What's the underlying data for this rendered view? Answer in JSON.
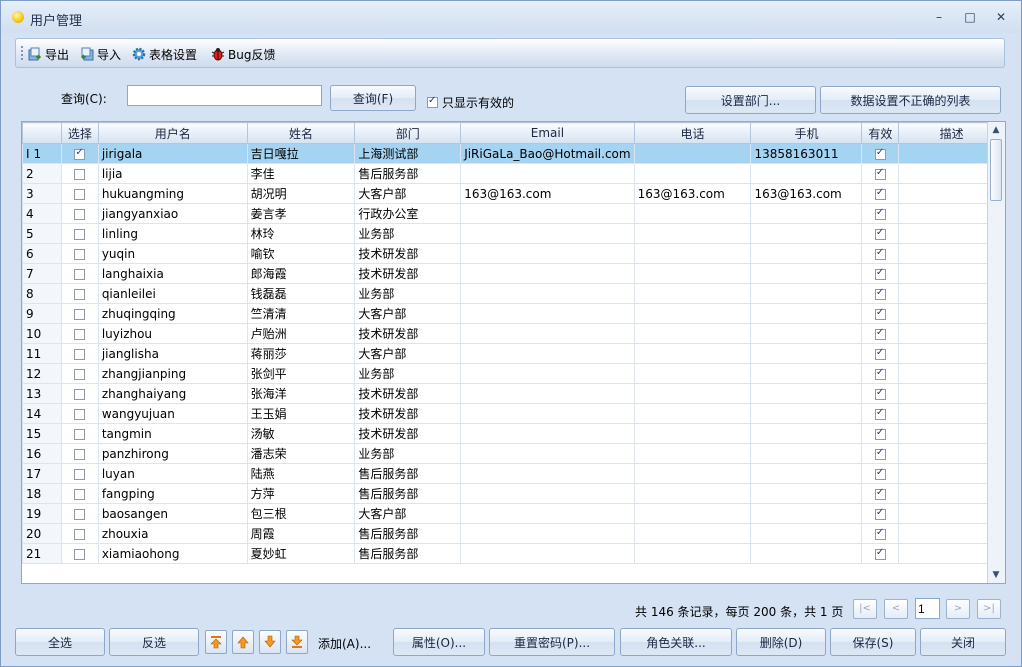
{
  "window": {
    "title": "用户管理",
    "controls": [
      "–",
      "□",
      "✕"
    ]
  },
  "toolbar": {
    "export_label": "导出",
    "import_label": "导入",
    "grid_settings_label": "表格设置",
    "bug_label": "Bug反馈"
  },
  "query": {
    "label": "查询(C):",
    "value": "",
    "button": "查询(F)",
    "only_valid_label": "只显示有效的",
    "only_valid_checked": true,
    "set_dept_button": "设置部门...",
    "bad_data_button": "数据设置不正确的列表"
  },
  "table": {
    "columns": [
      "",
      "选择",
      "用户名",
      "姓名",
      "部门",
      "Email",
      "电话",
      "手机",
      "有效",
      "描述"
    ],
    "rows": [
      {
        "num": "1",
        "indicator": "I",
        "select": true,
        "username": "jirigala",
        "name": "吉日嘎拉",
        "dept": "上海测试部",
        "email": "JiRiGaLa_Bao@Hotmail.com",
        "phone": "",
        "mobile": "13858163011",
        "valid": true,
        "desc": ""
      },
      {
        "num": "2",
        "select": false,
        "username": "lijia",
        "name": "李佳",
        "dept": "售后服务部",
        "email": "",
        "phone": "",
        "mobile": "",
        "valid": true,
        "desc": ""
      },
      {
        "num": "3",
        "select": false,
        "username": "hukuangming",
        "name": "胡况明",
        "dept": "大客户部",
        "email": "163@163.com",
        "phone": "163@163.com",
        "mobile": "163@163.com",
        "valid": true,
        "desc": ""
      },
      {
        "num": "4",
        "select": false,
        "username": "jiangyanxiao",
        "name": "姜言孝",
        "dept": "行政办公室",
        "email": "",
        "phone": "",
        "mobile": "",
        "valid": true,
        "desc": ""
      },
      {
        "num": "5",
        "select": false,
        "username": "linling",
        "name": "林玲",
        "dept": "业务部",
        "email": "",
        "phone": "",
        "mobile": "",
        "valid": true,
        "desc": ""
      },
      {
        "num": "6",
        "select": false,
        "username": "yuqin",
        "name": "喻钦",
        "dept": "技术研发部",
        "email": "",
        "phone": "",
        "mobile": "",
        "valid": true,
        "desc": ""
      },
      {
        "num": "7",
        "select": false,
        "username": "langhaixia",
        "name": "郎海霞",
        "dept": "技术研发部",
        "email": "",
        "phone": "",
        "mobile": "",
        "valid": true,
        "desc": ""
      },
      {
        "num": "8",
        "select": false,
        "username": "qianleilei",
        "name": "钱磊磊",
        "dept": "业务部",
        "email": "",
        "phone": "",
        "mobile": "",
        "valid": true,
        "desc": ""
      },
      {
        "num": "9",
        "select": false,
        "username": "zhuqingqing",
        "name": "竺清清",
        "dept": "大客户部",
        "email": "",
        "phone": "",
        "mobile": "",
        "valid": true,
        "desc": ""
      },
      {
        "num": "10",
        "select": false,
        "username": "luyizhou",
        "name": "卢贻洲",
        "dept": "技术研发部",
        "email": "",
        "phone": "",
        "mobile": "",
        "valid": true,
        "desc": ""
      },
      {
        "num": "11",
        "select": false,
        "username": "jianglisha",
        "name": "蒋丽莎",
        "dept": "大客户部",
        "email": "",
        "phone": "",
        "mobile": "",
        "valid": true,
        "desc": ""
      },
      {
        "num": "12",
        "select": false,
        "username": "zhangjianping",
        "name": "张剑平",
        "dept": "业务部",
        "email": "",
        "phone": "",
        "mobile": "",
        "valid": true,
        "desc": ""
      },
      {
        "num": "13",
        "select": false,
        "username": "zhanghaiyang",
        "name": "张海洋",
        "dept": "技术研发部",
        "email": "",
        "phone": "",
        "mobile": "",
        "valid": true,
        "desc": ""
      },
      {
        "num": "14",
        "select": false,
        "username": "wangyujuan",
        "name": "王玉娟",
        "dept": "技术研发部",
        "email": "",
        "phone": "",
        "mobile": "",
        "valid": true,
        "desc": ""
      },
      {
        "num": "15",
        "select": false,
        "username": "tangmin",
        "name": "汤敏",
        "dept": "技术研发部",
        "email": "",
        "phone": "",
        "mobile": "",
        "valid": true,
        "desc": ""
      },
      {
        "num": "16",
        "select": false,
        "username": "panzhirong",
        "name": "潘志荣",
        "dept": "业务部",
        "email": "",
        "phone": "",
        "mobile": "",
        "valid": true,
        "desc": ""
      },
      {
        "num": "17",
        "select": false,
        "username": "luyan",
        "name": "陆燕",
        "dept": "售后服务部",
        "email": "",
        "phone": "",
        "mobile": "",
        "valid": true,
        "desc": ""
      },
      {
        "num": "18",
        "select": false,
        "username": "fangping",
        "name": "方萍",
        "dept": "售后服务部",
        "email": "",
        "phone": "",
        "mobile": "",
        "valid": true,
        "desc": ""
      },
      {
        "num": "19",
        "select": false,
        "username": "baosangen",
        "name": "包三根",
        "dept": "大客户部",
        "email": "",
        "phone": "",
        "mobile": "",
        "valid": true,
        "desc": ""
      },
      {
        "num": "20",
        "select": false,
        "username": "zhouxia",
        "name": "周霞",
        "dept": "售后服务部",
        "email": "",
        "phone": "",
        "mobile": "",
        "valid": true,
        "desc": ""
      },
      {
        "num": "21",
        "select": false,
        "username": "xiamiaohong",
        "name": "夏妙虹",
        "dept": "售后服务部",
        "email": "",
        "phone": "",
        "mobile": "",
        "valid": true,
        "desc": ""
      }
    ]
  },
  "pager": {
    "summary": "共 146 条记录，每页 200 条，共 1 页",
    "page": "1",
    "first": "|<",
    "prev": "<",
    "next": ">",
    "last": ">|"
  },
  "bottom": {
    "select_all": "全选",
    "invert": "反选",
    "add": "添加(A)...",
    "properties": "属性(O)...",
    "reset_password": "重置密码(P)...",
    "role_link": "角色关联...",
    "delete": "删除(D)",
    "save": "保存(S)",
    "close": "关闭"
  },
  "colors": {
    "selected_row": "#a5d3f2",
    "window_bg": "#d4e2f4",
    "border": "#8fa8c8"
  }
}
